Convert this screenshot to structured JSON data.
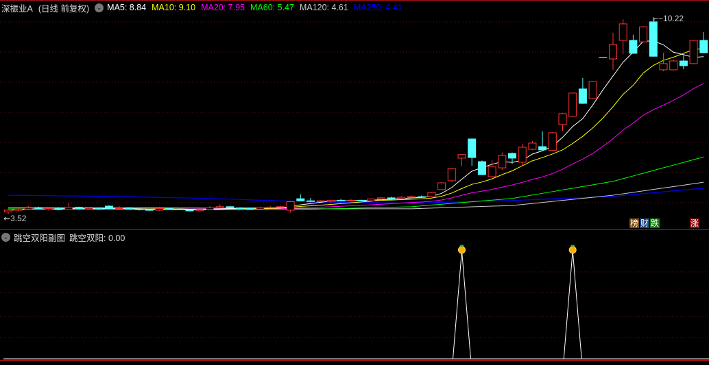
{
  "header": {
    "stock_name": "深振业A",
    "period": "(日线 前复权)",
    "ma": [
      {
        "label": "MA5: 8.84",
        "color": "#ffffff"
      },
      {
        "label": "MA10: 9.10",
        "color": "#ffff00"
      },
      {
        "label": "MA20: 7.95",
        "color": "#ff00ff"
      },
      {
        "label": "MA60: 5.47",
        "color": "#00ff00"
      },
      {
        "label": "MA120: 4.61",
        "color": "#cccccc"
      },
      {
        "label": "MA250: 4.41",
        "color": "#0000ff"
      }
    ]
  },
  "main_panel": {
    "max_label": "10.22",
    "min_label": "3.52",
    "badges": [
      {
        "label": "榜",
        "color": "#7a4a10"
      },
      {
        "label": "财",
        "color": "#1a3f7a"
      },
      {
        "label": "跌",
        "color": "#0a7a0a"
      },
      {
        "label": "涨",
        "color": "#8a0a0a"
      }
    ]
  },
  "sub_panel": {
    "title": "跳空双阳副图",
    "value_label": "跳空双阳: 0.00"
  },
  "colors": {
    "up": "#ff3333",
    "down": "#54ffff",
    "grid": "#6a1010",
    "separator": "#aa1111"
  },
  "chart_data": {
    "type": "candlestick",
    "price_range": [
      3.52,
      10.22
    ],
    "candles": [
      [
        3.6,
        3.66,
        3.7,
        3.52
      ],
      [
        3.66,
        3.7,
        3.74,
        3.62
      ],
      [
        3.7,
        3.74,
        3.8,
        3.66
      ],
      [
        3.74,
        3.7,
        3.78,
        3.68
      ],
      [
        3.68,
        3.72,
        3.76,
        3.65
      ],
      [
        3.72,
        3.68,
        3.75,
        3.66
      ],
      [
        3.68,
        3.76,
        3.9,
        3.66
      ],
      [
        3.76,
        3.7,
        3.78,
        3.68
      ],
      [
        3.7,
        3.73,
        3.76,
        3.67
      ],
      [
        3.72,
        3.7,
        3.75,
        3.68
      ],
      [
        3.8,
        3.72,
        3.83,
        3.7
      ],
      [
        3.72,
        3.74,
        3.8,
        3.7
      ],
      [
        3.74,
        3.7,
        3.76,
        3.68
      ],
      [
        3.7,
        3.68,
        3.72,
        3.65
      ],
      [
        3.68,
        3.66,
        3.7,
        3.64
      ],
      [
        3.66,
        3.72,
        3.78,
        3.64
      ],
      [
        3.72,
        3.7,
        3.74,
        3.68
      ],
      [
        3.7,
        3.68,
        3.72,
        3.66
      ],
      [
        3.66,
        3.64,
        3.68,
        3.62
      ],
      [
        3.64,
        3.68,
        3.72,
        3.62
      ],
      [
        3.68,
        3.74,
        3.8,
        3.66
      ],
      [
        3.74,
        3.78,
        3.86,
        3.72
      ],
      [
        3.78,
        3.74,
        3.8,
        3.72
      ],
      [
        3.74,
        3.72,
        3.76,
        3.7
      ],
      [
        3.72,
        3.7,
        3.74,
        3.68
      ],
      [
        3.7,
        3.74,
        3.78,
        3.68
      ],
      [
        3.74,
        3.76,
        3.8,
        3.72
      ],
      [
        3.76,
        3.78,
        3.82,
        3.74
      ],
      [
        3.66,
        3.95,
        3.97,
        3.58
      ],
      [
        4.05,
        3.98,
        4.2,
        3.96
      ],
      [
        3.98,
        3.96,
        4.08,
        3.94
      ],
      [
        3.96,
        3.98,
        4.0,
        3.94
      ],
      [
        3.96,
        4.0,
        4.02,
        3.9
      ],
      [
        4.0,
        3.98,
        4.04,
        3.96
      ],
      [
        3.98,
        4.0,
        4.04,
        3.96
      ],
      [
        4.0,
        3.99,
        4.02,
        3.97
      ],
      [
        3.98,
        4.04,
        4.06,
        3.96
      ],
      [
        4.04,
        4.08,
        4.1,
        4.0
      ],
      [
        4.08,
        4.06,
        4.12,
        4.04
      ],
      [
        4.06,
        4.1,
        4.14,
        4.04
      ],
      [
        4.1,
        4.12,
        4.16,
        4.08
      ],
      [
        4.12,
        4.1,
        4.16,
        4.08
      ],
      [
        4.12,
        4.26,
        4.28,
        4.1
      ],
      [
        4.36,
        4.59,
        4.62,
        4.34
      ],
      [
        4.66,
        5.08,
        5.1,
        4.62
      ],
      [
        5.43,
        5.55,
        5.56,
        5.15
      ],
      [
        6.08,
        5.45,
        6.1,
        5.17
      ],
      [
        5.31,
        4.87,
        5.35,
        4.85
      ],
      [
        4.8,
        5.15,
        5.36,
        4.78
      ],
      [
        5.1,
        5.52,
        5.62,
        5.03
      ],
      [
        5.59,
        5.43,
        5.62,
        5.24
      ],
      [
        5.29,
        5.8,
        5.92,
        5.17
      ],
      [
        5.73,
        5.94,
        6.01,
        5.7
      ],
      [
        5.82,
        5.71,
        6.34,
        5.69
      ],
      [
        5.69,
        6.29,
        6.31,
        5.67
      ],
      [
        6.57,
        6.94,
        6.96,
        6.36
      ],
      [
        6.85,
        7.64,
        7.66,
        6.83
      ],
      [
        7.78,
        7.29,
        8.15,
        7.27
      ],
      [
        7.45,
        8.03,
        8.05,
        7.43
      ],
      [
        8.85,
        8.85,
        8.85,
        8.85
      ],
      [
        8.8,
        9.29,
        9.69,
        8.43
      ],
      [
        9.43,
        9.99,
        10.15,
        8.96
      ],
      [
        9.43,
        8.99,
        9.62,
        8.97
      ],
      [
        9.38,
        9.89,
        9.91,
        9.36
      ],
      [
        10.06,
        8.89,
        10.22,
        8.87
      ],
      [
        8.43,
        8.64,
        9.01,
        8.38
      ],
      [
        8.43,
        8.73,
        8.78,
        8.41
      ],
      [
        8.73,
        8.57,
        8.92,
        8.45
      ],
      [
        8.64,
        9.43,
        9.45,
        8.62
      ],
      [
        9.43,
        9.01,
        9.71,
        8.99
      ]
    ],
    "long_ma_sample_index": [
      0,
      10,
      20,
      30,
      40,
      50,
      60,
      69
    ],
    "ma60": [
      3.71,
      3.69,
      3.67,
      3.69,
      3.78,
      4.06,
      4.64,
      5.47
    ],
    "ma120": [
      3.75,
      3.75,
      3.73,
      3.71,
      3.71,
      3.82,
      4.17,
      4.61
    ],
    "ma250": [
      4.17,
      4.13,
      4.06,
      3.94,
      3.9,
      3.99,
      4.13,
      4.41
    ],
    "signal_indices": [
      45,
      56
    ],
    "signal_range": [
      0,
      1
    ]
  }
}
